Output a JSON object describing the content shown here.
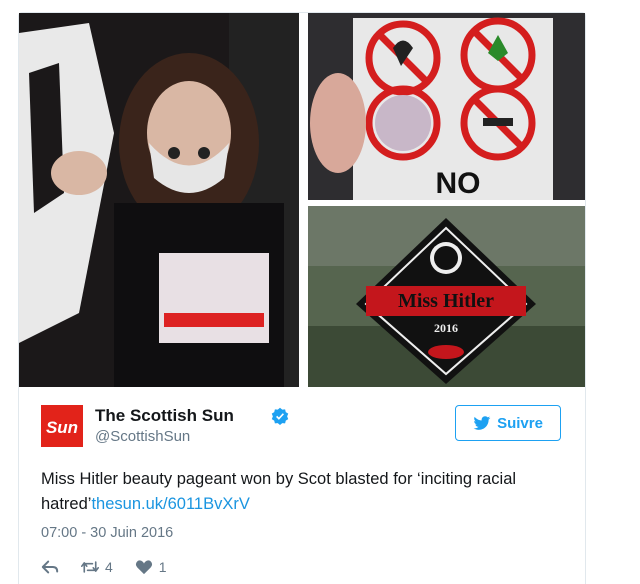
{
  "tweet": {
    "author_name": "The Scottish Sun",
    "author_handle": "@ScottishSun",
    "logo_text": "Sun",
    "follow_label": "Suivre",
    "text_before": "Miss Hitler beauty pageant won by Scot blasted for ‘inciting racial hatred’",
    "link_text": "thesun.uk/6011BvXrV",
    "timestamp": "07:00 - 30 Juin 2016",
    "retweets": "4",
    "likes": "1"
  },
  "images": {
    "photo2_caption": "NO",
    "photo3_title": "Miss Hitler",
    "photo3_year": "2016"
  },
  "colors": {
    "accent": "#1da1f2",
    "brand_red": "#e2231a",
    "muted": "#657786"
  },
  "icons": {
    "verified": "verified-badge-icon",
    "follow": "bird-icon",
    "reply": "reply-icon",
    "retweet": "retweet-icon",
    "like": "heart-icon"
  }
}
